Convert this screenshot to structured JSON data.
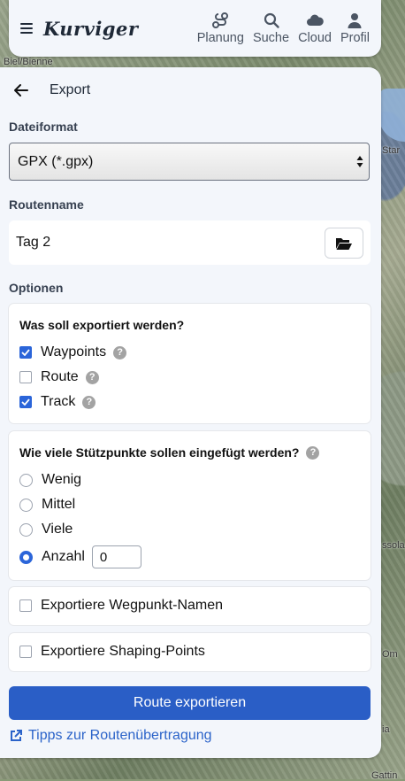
{
  "header": {
    "logo": "Kurviger",
    "nav": [
      {
        "label": "Planung",
        "icon": "route-planning-icon"
      },
      {
        "label": "Suche",
        "icon": "search-icon"
      },
      {
        "label": "Cloud",
        "icon": "cloud-icon"
      },
      {
        "label": "Profil",
        "icon": "user-icon"
      }
    ]
  },
  "map": {
    "labels": [
      "Biel/Bienne",
      "Star",
      "ssola",
      "Om",
      "ia",
      "Gattin"
    ]
  },
  "panel": {
    "title": "Export",
    "format_label": "Dateiformat",
    "format_value": "GPX (*.gpx)",
    "routename_label": "Routenname",
    "routename_value": "Tag 2",
    "options_label": "Optionen",
    "what_title": "Was soll exportiert werden?",
    "what_options": [
      {
        "label": "Waypoints",
        "checked": true
      },
      {
        "label": "Route",
        "checked": false
      },
      {
        "label": "Track",
        "checked": true
      }
    ],
    "points_title": "Wie viele Stützpunkte sollen eingefügt werden?",
    "points_options": [
      {
        "label": "Wenig",
        "selected": false
      },
      {
        "label": "Mittel",
        "selected": false
      },
      {
        "label": "Viele",
        "selected": false
      },
      {
        "label": "Anzahl",
        "selected": true
      }
    ],
    "anzahl_value": "0",
    "export_waypoint_names": "Exportiere Wegpunkt-Namen",
    "export_shaping_points": "Exportiere Shaping-Points",
    "export_button": "Route exportieren",
    "tips_link": "Tipps zur Routenübertragung"
  },
  "colors": {
    "accent": "#2a5ec6",
    "link": "#2b63c9"
  }
}
